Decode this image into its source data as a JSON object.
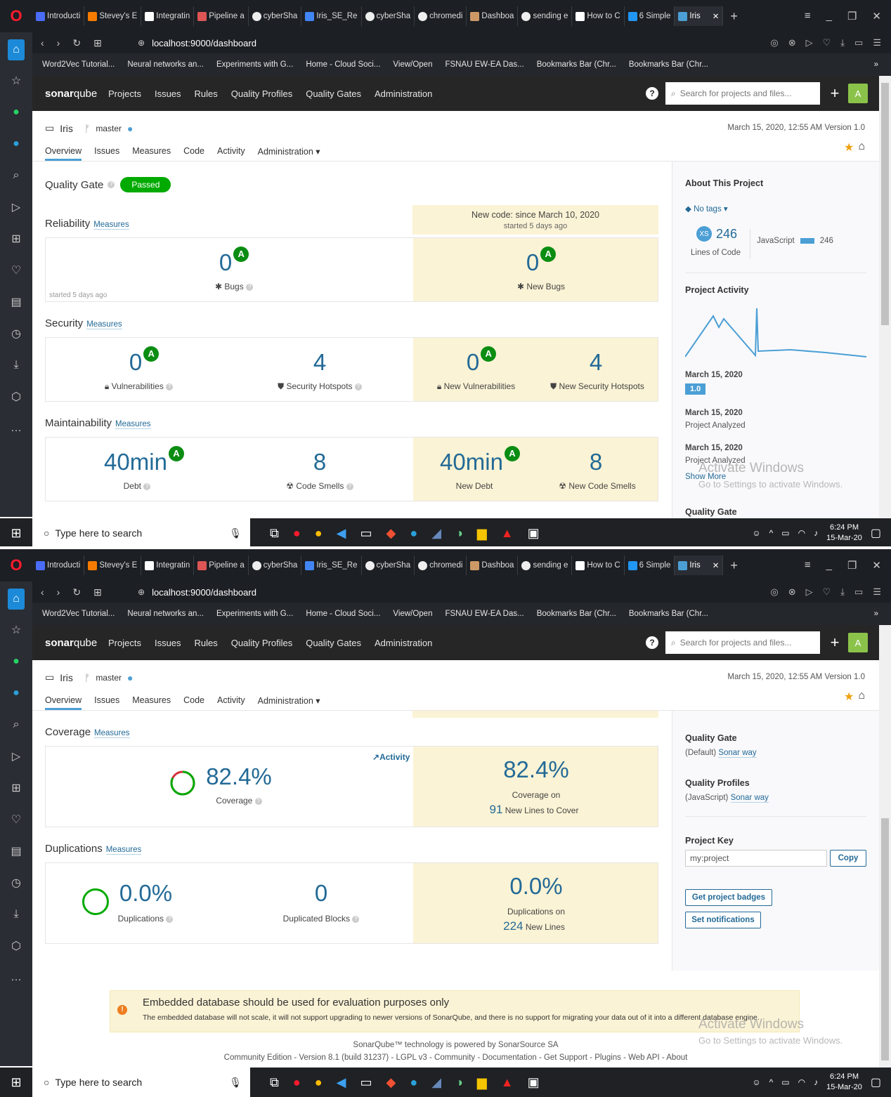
{
  "browser": {
    "tabs": [
      "Introducti",
      "Stevey's E",
      "Integratin",
      "Pipeline a",
      "cyberSha",
      "Iris_SE_Re",
      "cyberSha",
      "chromedi",
      "Dashboa",
      "sending e",
      "How to C",
      "6 Simple",
      "Iris"
    ],
    "url": "localhost:9000/dashboard",
    "bookmarks": [
      "Word2Vec Tutorial...",
      "Neural networks an...",
      "Experiments with G...",
      "Home - Cloud Soci...",
      "View/Open",
      "FSNAU EW-EA Das...",
      "Bookmarks Bar (Chr...",
      "Bookmarks Bar (Chr..."
    ],
    "bookmarks_more": "»"
  },
  "sq": {
    "logo_a": "sonar",
    "logo_b": "qube",
    "menu": [
      "Projects",
      "Issues",
      "Rules",
      "Quality Profiles",
      "Quality Gates",
      "Administration"
    ],
    "search_placeholder": "Search for projects and files...",
    "avatar": "A"
  },
  "project": {
    "name": "Iris",
    "branch": "master",
    "meta": "March 15, 2020, 12:55 AM  Version 1.0",
    "tabs": [
      "Overview",
      "Issues",
      "Measures",
      "Code",
      "Activity",
      "Administration ▾"
    ]
  },
  "overview": {
    "quality_gate_label": "Quality Gate",
    "quality_gate_status": "Passed",
    "new_code_title": "New code: since March 10, 2020",
    "new_code_sub": "started 5 days ago",
    "started": "started 5 days ago",
    "measures_link": "Measures",
    "reliability": {
      "title": "Reliability",
      "bugs": "0",
      "bugs_label": "Bugs",
      "new_bugs": "0",
      "new_bugs_label": "New Bugs",
      "rating": "A"
    },
    "security": {
      "title": "Security",
      "vulns": "0",
      "vulns_label": "Vulnerabilities",
      "hotspots": "4",
      "hotspots_label": "Security Hotspots",
      "new_vulns": "0",
      "new_vulns_label": "New Vulnerabilities",
      "new_hotspots": "4",
      "new_hotspots_label": "New Security Hotspots"
    },
    "maint": {
      "title": "Maintainability",
      "debt": "40min",
      "debt_label": "Debt",
      "smells": "8",
      "smells_label": "Code Smells",
      "new_debt": "40min",
      "new_debt_label": "New Debt",
      "new_smells": "8",
      "new_smells_label": "New Code Smells"
    },
    "coverage": {
      "title": "Coverage",
      "value": "82.4%",
      "label": "Coverage",
      "activity": "Activity",
      "new_value": "82.4%",
      "new_label": "Coverage on",
      "new_lines": "91",
      "new_lines_label": "New Lines to Cover",
      "fraction": 0.824
    },
    "dup": {
      "title": "Duplications",
      "value": "0.0%",
      "label": "Duplications",
      "blocks": "0",
      "blocks_label": "Duplicated Blocks",
      "new_value": "0.0%",
      "new_label": "Duplications on",
      "new_lines": "224",
      "new_lines_label": "New Lines"
    }
  },
  "about": {
    "title": "About This Project",
    "tags": "No tags ▾",
    "size": "XS",
    "loc": "246",
    "loc_label": "Lines of Code",
    "lang": "JavaScript",
    "lang_loc": "246",
    "activity_title": "Project Activity",
    "events": [
      {
        "date": "March 15, 2020",
        "version": "1.0"
      },
      {
        "date": "March 15, 2020",
        "text": "Project Analyzed"
      },
      {
        "date": "March 15, 2020",
        "text": "Project Analyzed"
      }
    ],
    "show_more": "Show More",
    "qg_title": "Quality Gate",
    "qg_default": "(Default)",
    "qg_link": "Sonar way",
    "qp_title": "Quality Profiles",
    "qp_lang": "(JavaScript)",
    "qp_link": "Sonar way",
    "key_title": "Project Key",
    "key": "my:project",
    "copy": "Copy",
    "badges": "Get project badges",
    "notifications": "Set notifications"
  },
  "notice": {
    "title": "Embedded database should be used for evaluation purposes only",
    "text": "The embedded database will not scale, it will not support upgrading to newer versions of SonarQube, and there is no support for migrating your data out of it into a different database engine."
  },
  "footer": {
    "line1": "SonarQube™ technology is powered by SonarSource SA",
    "line2": "Community Edition - Version 8.1 (build 31237) - LGPL v3 - Community - Documentation - Get Support - Plugins - Web API - About"
  },
  "windows": {
    "activate": "Activate Windows",
    "activate_sub": "Go to Settings to activate Windows.",
    "search": "Type here to search",
    "time": "6:24 PM",
    "date": "15-Mar-20"
  }
}
